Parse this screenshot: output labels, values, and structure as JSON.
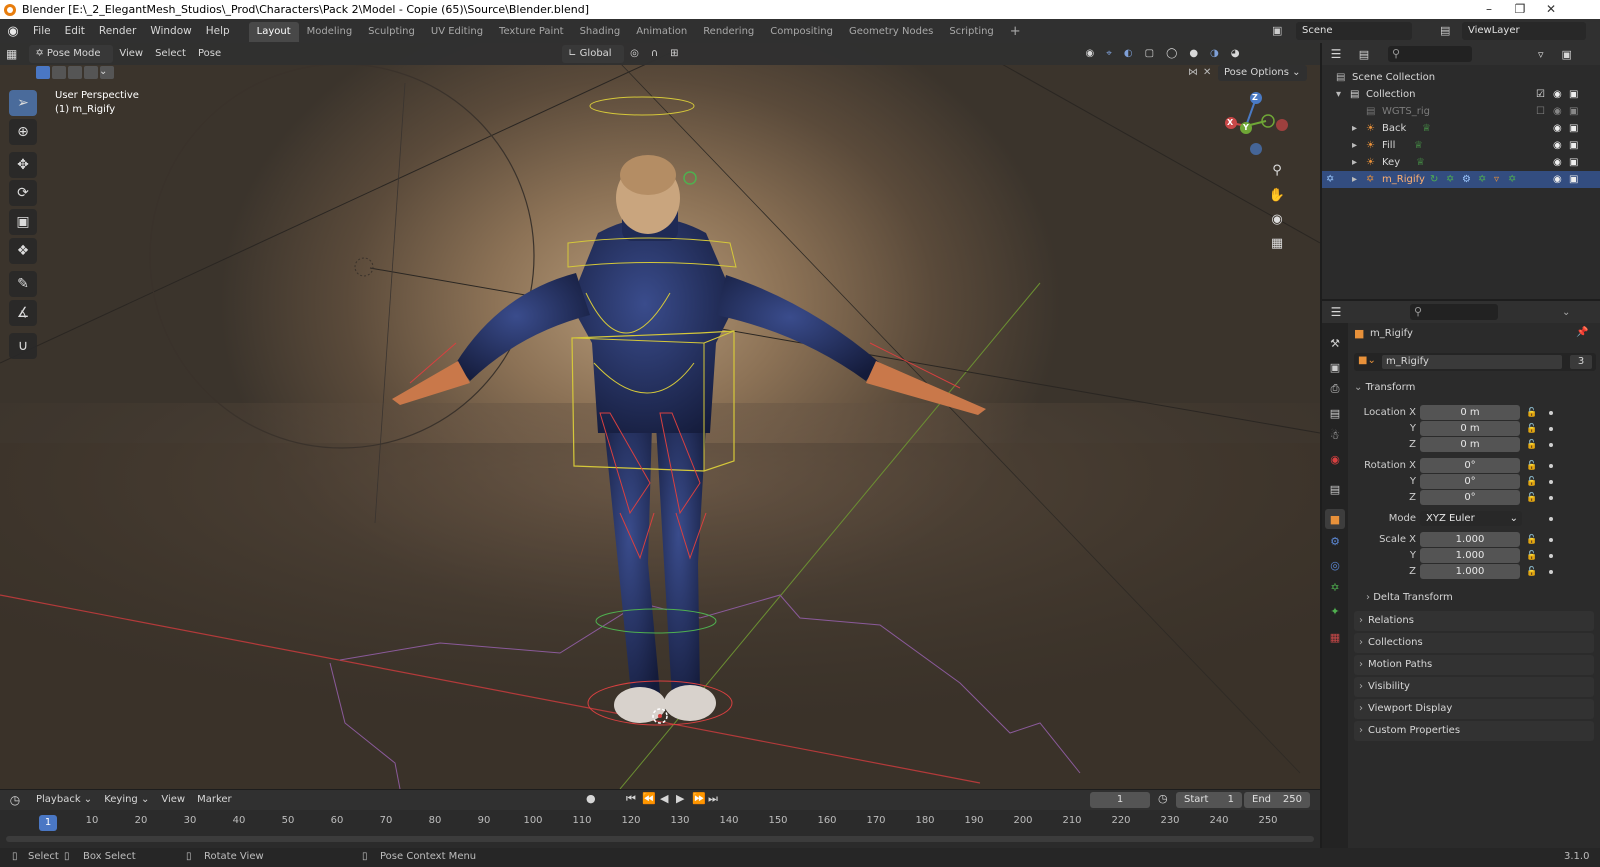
{
  "window": {
    "title": "Blender [E:\\_2_ElegantMesh_Studios\\_Prod\\Characters\\Pack 2\\Model - Copie (65)\\Source\\Blender.blend]"
  },
  "menu": {
    "items": [
      "File",
      "Edit",
      "Render",
      "Window",
      "Help"
    ]
  },
  "workspaces": {
    "tabs": [
      "Layout",
      "Modeling",
      "Sculpting",
      "UV Editing",
      "Texture Paint",
      "Shading",
      "Animation",
      "Rendering",
      "Compositing",
      "Geometry Nodes",
      "Scripting"
    ],
    "active": "Layout",
    "add": "+"
  },
  "topright": {
    "scene": "Scene",
    "view_layer": "ViewLayer"
  },
  "viewport": {
    "mode": "Pose Mode",
    "menus": [
      "View",
      "Select",
      "Pose"
    ],
    "orientation": "Global",
    "pose_options": "Pose Options",
    "perspective_label": "User Perspective",
    "object_label": "(1) m_Rigify",
    "gizmo": {
      "x": "X",
      "y": "Y",
      "z": "Z"
    }
  },
  "outliner": {
    "rows": [
      {
        "label": "Scene Collection",
        "indent": 0
      },
      {
        "label": "Collection",
        "indent": 1
      },
      {
        "label": "WGTS_rig",
        "indent": 2
      },
      {
        "label": "Back",
        "indent": 2
      },
      {
        "label": "Fill",
        "indent": 2
      },
      {
        "label": "Key",
        "indent": 2
      },
      {
        "label": "m_Rigify",
        "indent": 2
      }
    ]
  },
  "properties": {
    "object_name": "m_Rigify",
    "datablock_name": "m_Rigify",
    "users": "3",
    "transform_title": "Transform",
    "location": {
      "label": "Location X",
      "x": "0 m",
      "y": "0 m",
      "z": "0 m"
    },
    "rotation": {
      "label": "Rotation X",
      "x": "0°",
      "y": "0°",
      "z": "0°"
    },
    "mode": {
      "label": "Mode",
      "value": "XYZ Euler"
    },
    "scale": {
      "label": "Scale X",
      "x": "1.000",
      "y": "1.000",
      "z": "1.000"
    },
    "axis_y": "Y",
    "axis_z": "Z",
    "delta_transform": "Delta Transform",
    "panels": [
      "Relations",
      "Collections",
      "Motion Paths",
      "Visibility",
      "Viewport Display",
      "Custom Properties"
    ]
  },
  "timeline": {
    "menus": [
      "Playback",
      "Keying",
      "View",
      "Marker"
    ],
    "current_frame": "1",
    "start_label": "Start",
    "start": "1",
    "end_label": "End",
    "end": "250",
    "ticks": [
      "10",
      "20",
      "30",
      "40",
      "50",
      "60",
      "70",
      "80",
      "90",
      "100",
      "110",
      "120",
      "130",
      "140",
      "150",
      "160",
      "170",
      "180",
      "190",
      "200",
      "210",
      "220",
      "230",
      "240",
      "250"
    ]
  },
  "status": {
    "select": "Select",
    "box_select": "Box Select",
    "rotate_view": "Rotate View",
    "context_menu": "Pose Context Menu",
    "version": "3.1.0"
  },
  "colors": {
    "accent": "#4a77c4",
    "selected_row": "#334d80",
    "header": "#303030"
  }
}
